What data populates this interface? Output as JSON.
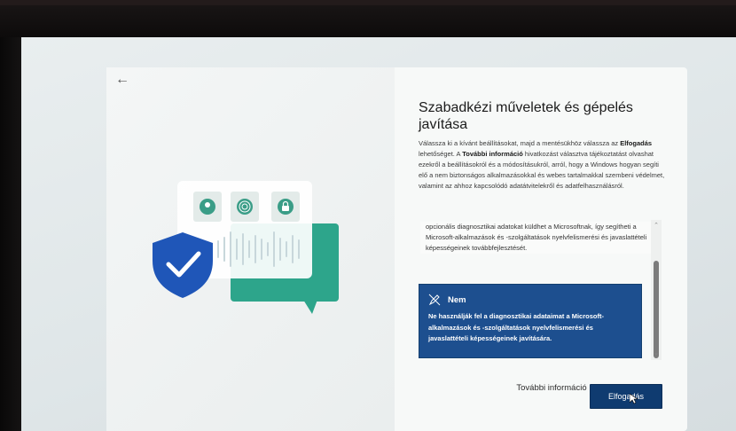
{
  "dialog": {
    "title": "Szabadkézi műveletek és gépelés javítása",
    "description": {
      "p1": "Válassza ki a kívánt beállításokat, majd a mentésükhöz válassza az ",
      "b1": "Elfogadás",
      "p2": " lehetőséget. A ",
      "b2": "További információ",
      "p3": " hivatkozást választva tájékoztatást olvashat ezekről a beállításokról és a módosításukról, arról, hogy a Windows hogyan segíti elő a nem biztonságos alkalmazásokkal és webes tartalmakkal szembeni védelmet, valamint az ahhoz kapcsolódó adatátvitelekről és adatfelhasználásról."
    },
    "snippet": "opcionális diagnosztikai adatokat küldhet a Microsoftnak, így segítheti a Microsoft-alkalmazások és -szolgáltatások nyelvfelismerési és javaslattételi képességeinek továbbfejlesztését.",
    "option": {
      "title": "Nem",
      "text": "Ne használják fel a diagnosztikai adataimat a Microsoft-alkalmazások és -szolgáltatások nyelvfelismerési és javaslattételi képességeinek javítására.",
      "icon": "pen-off-icon"
    },
    "buttons": {
      "more_info": "További információ",
      "accept": "Elfogadás"
    }
  },
  "colors": {
    "accent": "#0f3b70",
    "option_bg": "#1d4f8f",
    "shield": "#1f56b8",
    "bubble": "#2da58b",
    "icon_green": "#3a9d87"
  }
}
